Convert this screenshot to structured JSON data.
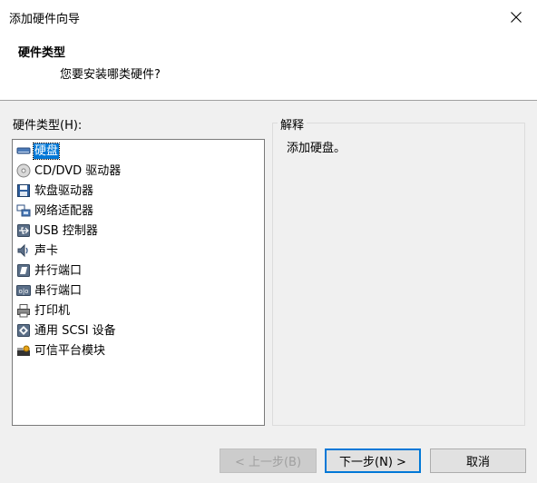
{
  "window": {
    "title": "添加硬件向导",
    "close_icon": "close-icon"
  },
  "header": {
    "title": "硬件类型",
    "subtitle": "您要安装哪类硬件?"
  },
  "hardware_list": {
    "label": "硬件类型(H):",
    "items": [
      {
        "label": "硬盘",
        "icon": "hard-disk-icon",
        "selected": true
      },
      {
        "label": "CD/DVD 驱动器",
        "icon": "cd-dvd-icon",
        "selected": false
      },
      {
        "label": "软盘驱动器",
        "icon": "floppy-icon",
        "selected": false
      },
      {
        "label": "网络适配器",
        "icon": "network-adapter-icon",
        "selected": false
      },
      {
        "label": "USB 控制器",
        "icon": "usb-icon",
        "selected": false
      },
      {
        "label": "声卡",
        "icon": "sound-card-icon",
        "selected": false
      },
      {
        "label": "并行端口",
        "icon": "parallel-port-icon",
        "selected": false
      },
      {
        "label": "串行端口",
        "icon": "serial-port-icon",
        "selected": false
      },
      {
        "label": "打印机",
        "icon": "printer-icon",
        "selected": false
      },
      {
        "label": "通用 SCSI 设备",
        "icon": "scsi-icon",
        "selected": false
      },
      {
        "label": "可信平台模块",
        "icon": "tpm-icon",
        "selected": false
      }
    ]
  },
  "description": {
    "legend": "解释",
    "text": "添加硬盘。"
  },
  "buttons": {
    "back": "< 上一步(B)",
    "next": "下一步(N) >",
    "cancel": "取消"
  },
  "colors": {
    "selection": "#0078d7",
    "dialog_bg": "#f0f0f0"
  }
}
